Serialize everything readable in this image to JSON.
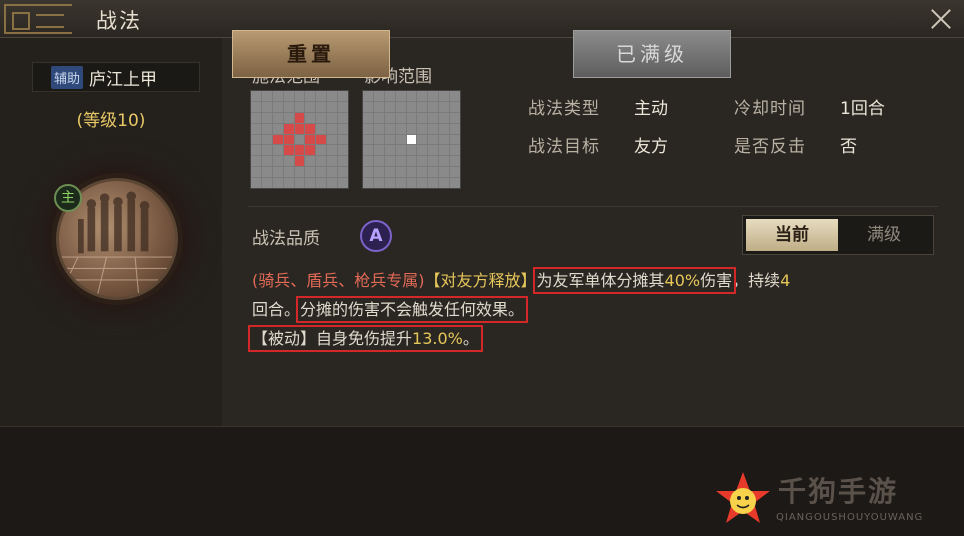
{
  "window": {
    "title": "战法"
  },
  "general": {
    "role_badge": "辅助",
    "name": "庐江上甲",
    "level": "(等级10)",
    "main_badge": "主"
  },
  "skill": {
    "cast_range_label": "施法范围",
    "effect_range_label": "影响范围",
    "type_label": "战法类型",
    "type_value": "主动",
    "cooldown_label": "冷却时间",
    "cooldown_value": "1回合",
    "target_label": "战法目标",
    "target_value": "友方",
    "counter_label": "是否反击",
    "counter_value": "否",
    "quality_label": "战法品质",
    "quality_value": "A",
    "tabs": {
      "current": "当前",
      "max": "满级"
    },
    "description": {
      "troops": "(骑兵、盾兵、枪兵专属)",
      "trigger": "【对友方释放】",
      "part1_a": "为友军单体分摊其",
      "part1_pct": "40%",
      "part1_b": "伤害",
      "part2": "，持续",
      "part2_num": "4",
      "part3": "回合。",
      "part4": "分摊的伤害不会触发任何效果。",
      "passive_a": "【被动】自身免伤提升",
      "passive_pct": "13.0%",
      "passive_b": "。"
    }
  },
  "buttons": {
    "reset": "重置",
    "maxed": "已满级"
  },
  "watermark": {
    "text": "千狗手游",
    "sub": "QIANGOUSHOUYOUWANG"
  },
  "colors": {
    "accent_red": "#d42828",
    "highlight_yellow": "#e6c75a",
    "troop_red": "#e06a56",
    "grid_red": "#d64a4a"
  }
}
